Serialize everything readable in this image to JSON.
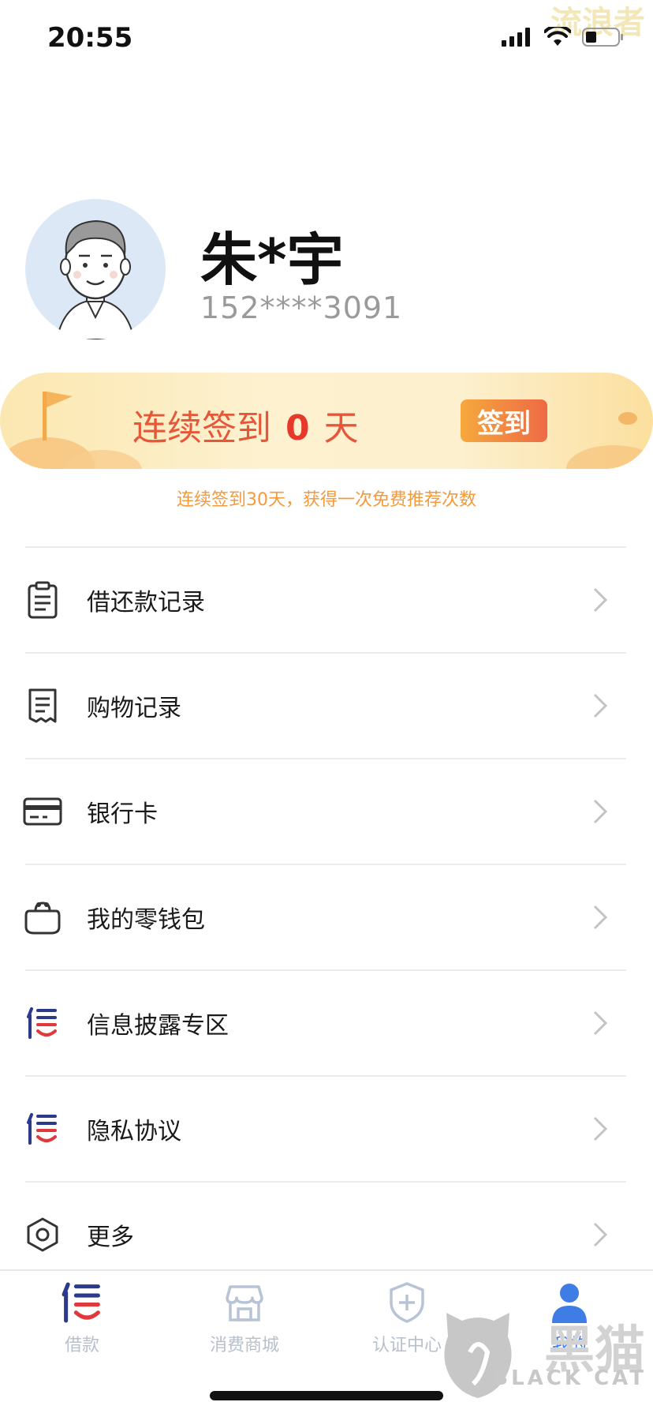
{
  "status_bar": {
    "time": "20:55",
    "watermark": "流浪者"
  },
  "profile": {
    "name": "朱*宇",
    "phone": "152****3091"
  },
  "signin": {
    "prefix": "连续签到",
    "days": "0",
    "suffix": "天",
    "button_label": "签到",
    "hint": "连续签到30天，获得一次免费推荐次数"
  },
  "menu": {
    "items": [
      {
        "label": "借还款记录",
        "icon": "clipboard-icon"
      },
      {
        "label": "购物记录",
        "icon": "receipt-icon"
      },
      {
        "label": "银行卡",
        "icon": "bank-card-icon"
      },
      {
        "label": "我的零钱包",
        "icon": "wallet-icon"
      },
      {
        "label": "信息披露专区",
        "icon": "xin-logo-icon"
      },
      {
        "label": "隐私协议",
        "icon": "xin-logo-icon"
      },
      {
        "label": "更多",
        "icon": "hexagon-gear-icon"
      }
    ]
  },
  "tabbar": {
    "tabs": [
      {
        "label": "借款",
        "icon": "xin-logo-icon",
        "active": false
      },
      {
        "label": "消费商城",
        "icon": "store-icon",
        "active": false
      },
      {
        "label": "认证中心",
        "icon": "shield-plus-icon",
        "active": false
      },
      {
        "label": "我的",
        "icon": "person-icon",
        "active": true
      }
    ]
  },
  "brand_watermark": {
    "cn": "黑猫",
    "en": "BLACK CAT"
  },
  "colors": {
    "accent": "#3f7de6",
    "signin_red": "#e8382a",
    "hint_orange": "#f29a3c"
  }
}
